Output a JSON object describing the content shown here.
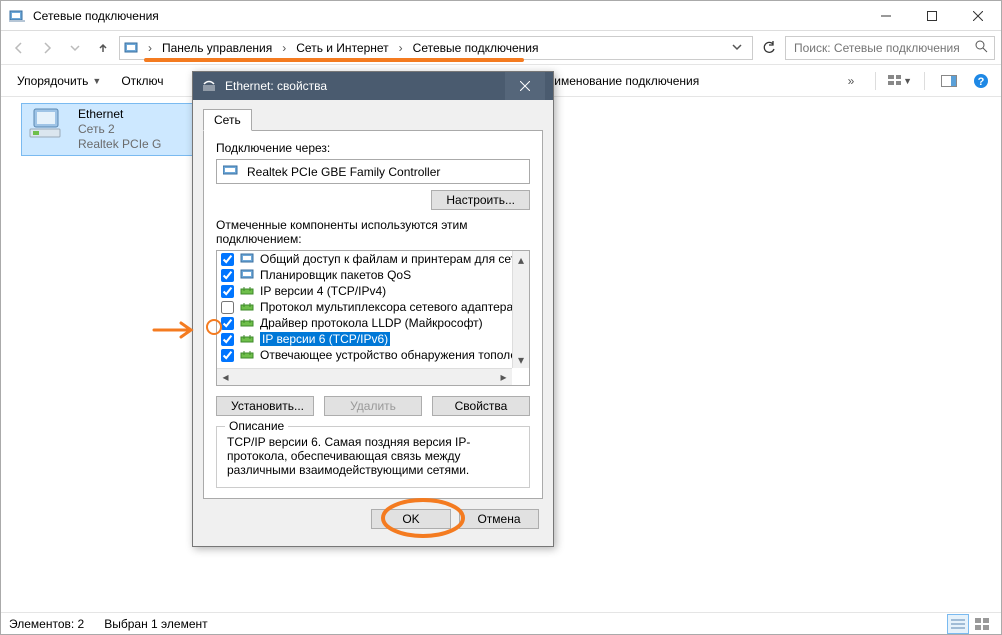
{
  "window": {
    "title": "Сетевые подключения"
  },
  "breadcrumb": {
    "items": [
      "Панель управления",
      "Сеть и Интернет",
      "Сетевые подключения"
    ]
  },
  "search": {
    "placeholder": "Поиск: Сетевые подключения"
  },
  "cmdbar": {
    "organize": "Упорядочить",
    "disable": "Отключ",
    "rename": "еименование подключения"
  },
  "connection": {
    "name": "Ethernet",
    "network": "Сеть 2",
    "adapter": "Realtek PCIe G"
  },
  "statusbar": {
    "elements": "Элементов: 2",
    "selected": "Выбран 1 элемент"
  },
  "dialog": {
    "title": "Ethernet: свойства",
    "tab": "Сеть",
    "connect_via": "Подключение через:",
    "adapter": "Realtek PCIe GBE Family Controller",
    "configure": "Настроить...",
    "components_label": "Отмеченные компоненты используются этим подключением:",
    "components": [
      {
        "checked": true,
        "icon": "monitor",
        "label": "Общий доступ к файлам и принтерам для сетей Mi"
      },
      {
        "checked": true,
        "icon": "monitor",
        "label": "Планировщик пакетов QoS"
      },
      {
        "checked": true,
        "icon": "proto",
        "label": "IP версии 4 (TCP/IPv4)"
      },
      {
        "checked": false,
        "icon": "proto",
        "label": "Протокол мультиплексора сетевого адаптера (Ма"
      },
      {
        "checked": true,
        "icon": "proto",
        "label": "Драйвер протокола LLDP (Майкрософт)"
      },
      {
        "checked": true,
        "icon": "proto",
        "label": "IP версии 6 (TCP/IPv6)",
        "selected": true
      },
      {
        "checked": true,
        "icon": "proto",
        "label": "Отвечающее устройство обнаружения топологии к"
      }
    ],
    "install": "Установить...",
    "uninstall": "Удалить",
    "properties": "Свойства",
    "desc_label": "Описание",
    "description": "TCP/IP версии 6. Самая поздняя версия IP-протокола, обеспечивающая связь между различными взаимодействующими сетями.",
    "ok": "OK",
    "cancel": "Отмена"
  }
}
